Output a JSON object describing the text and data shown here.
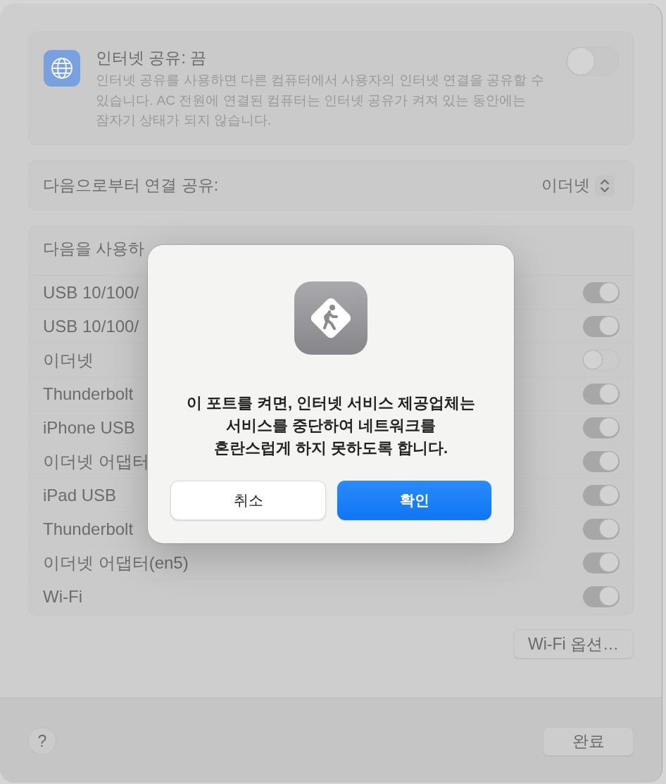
{
  "sharing": {
    "title": "인터넷 공유: 끔",
    "description": "인터넷 공유를 사용하면 다른 컴퓨터에서 사용자의 인터넷 연결을 공유할 수\n있습니다. AC 전원에 연결된 컴퓨터는 인터넷 공유가 켜져 있는 동안에는\n잠자기 상태가 되지 않습니다.",
    "on": false
  },
  "share_from": {
    "label": "다음으로부터 연결 공유:",
    "value": "이더넷"
  },
  "ports": {
    "header": "다음을 사용하",
    "items": [
      {
        "name": "USB 10/100/",
        "on": true
      },
      {
        "name": "USB 10/100/",
        "on": true
      },
      {
        "name": "이더넷",
        "on": false
      },
      {
        "name": "Thunderbolt",
        "on": true
      },
      {
        "name": "iPhone USB",
        "on": true
      },
      {
        "name": "이더넷 어댑터",
        "on": true
      },
      {
        "name": "iPad USB",
        "on": true
      },
      {
        "name": "Thunderbolt",
        "on": true
      },
      {
        "name": "이더넷 어댑터(en5)",
        "on": true
      },
      {
        "name": "Wi-Fi",
        "on": true
      }
    ]
  },
  "wifi_options_button": "Wi-Fi 옵션…",
  "footer": {
    "help": "?",
    "done": "완료"
  },
  "alert": {
    "message": "이 포트를 켜면, 인터넷 서비스 제공업체는\n서비스를 중단하여 네트워크를\n혼란스럽게 하지 못하도록 합니다.",
    "buttons": [
      {
        "label": "취소",
        "kind": "secondary"
      },
      {
        "label": "확인",
        "kind": "default"
      }
    ]
  }
}
